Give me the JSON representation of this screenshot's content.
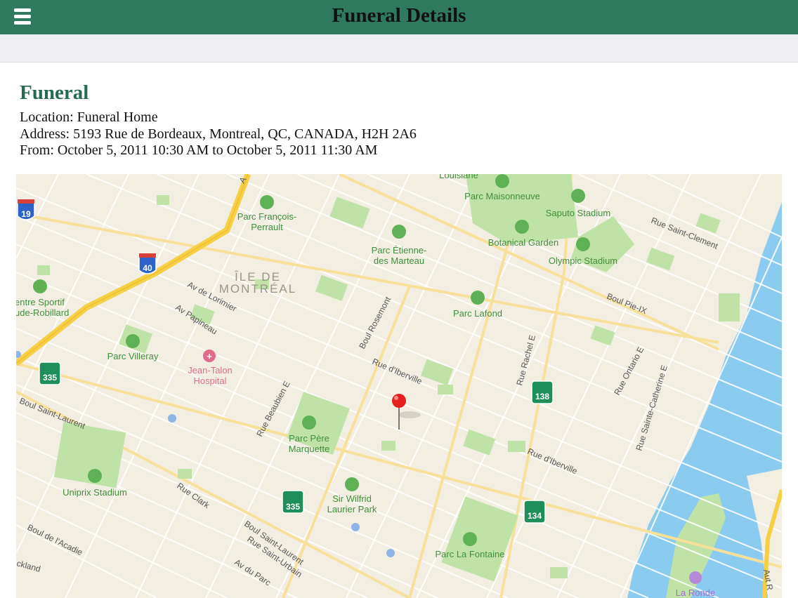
{
  "header": {
    "title": "Funeral Details"
  },
  "event": {
    "heading": "Funeral",
    "location_line": "Location: Funeral Home",
    "address_line": "Address: 5193 Rue de Bordeaux, Montreal, QC, CANADA, H2H 2A6",
    "time_line": "From: October 5, 2011 10:30 AM to October 5, 2011 11:30 AM"
  },
  "map": {
    "island_label_1": "ÎLE DE",
    "island_label_2": "MONTRÉAL",
    "parks": {
      "maisonneuve": "Parc Maisonneuve",
      "francois_1": "Parc François-",
      "francois_2": "Perrault",
      "etienne_1": "Parc Étienne-",
      "etienne_2": "des Marteau",
      "lafond": "Parc Lafond",
      "villeray": "Parc Villeray",
      "pere_marquette_1": "Parc Père",
      "pere_marquette_2": "Marquette",
      "sir_wilfrid_1": "Sir Wilfrid",
      "sir_wilfrid_2": "Laurier Park",
      "la_fontaine": "Parc La Fontaine",
      "botanical": "Botanical Garden",
      "centre_sportif_1": "entre Sportif",
      "centre_sportif_2": "ude-Robillard",
      "louisiane": "Louisiane"
    },
    "stadiums": {
      "saputo": "Saputo Stadium",
      "olympic": "Olympic Stadium",
      "uniprix": "Uniprix Stadium"
    },
    "hospital_1": "Jean-Talon",
    "hospital_2": "Hospital",
    "la_ronde": "La Ronde",
    "streets": {
      "lorimier": "Av de Lorimier",
      "papineau": "Av Papineau",
      "rosemont": "Boul Rosemont",
      "iberville_1": "Rue d'Iberville",
      "iberville_2": "Rue d'Iberville",
      "saint_clement": "Rue Saint-Clement",
      "pie_ix": "Boul Pie-IX",
      "rachel": "Rue Rachel E",
      "ontario": "Rue Ontario E",
      "sainte_catherine": "Rue Sainte-Catherine E",
      "beaubien": "Rue Beaubien E",
      "saint_laurent_1": "Boul Saint-Laurent",
      "saint_laurent_2": "Boul Saint-Laurent",
      "clark": "Rue Clark",
      "saint_urbain": "Rue Saint-Urbain",
      "acadie": "Boul de l'Acadie",
      "du_parc": "Av du Parc",
      "ackland": "ckland",
      "aut_r": "Aut R",
      "top_a": "A"
    },
    "shields": {
      "i19": "19",
      "i40": "40",
      "r335a": "335",
      "r335b": "335",
      "r138": "138",
      "r134": "134"
    },
    "colors": {
      "land": "#f3eee2",
      "park": "#bfe3a6",
      "water": "#8ccbf0",
      "highway": "#f6cf45",
      "park_text": "#3f8f3a"
    }
  }
}
